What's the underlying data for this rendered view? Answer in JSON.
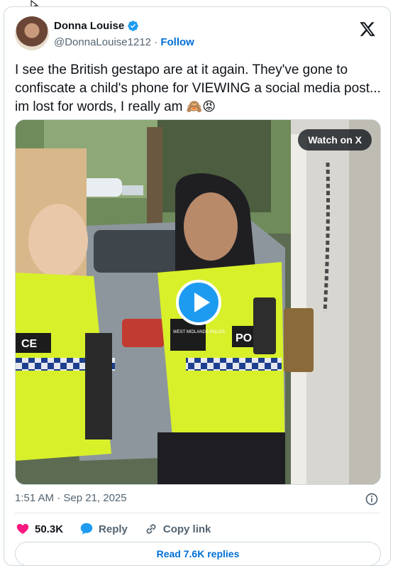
{
  "author": {
    "display_name": "Donna Louise",
    "handle": "@DonnaLouise1212",
    "separator": " · ",
    "follow_label": "Follow",
    "verified": true
  },
  "tweet": {
    "text": "I see the British gestapo are at it again. They've gone to confiscate a child's phone for VIEWING a social media post... im lost for words, I really am ",
    "emojis": "🙈😡"
  },
  "media": {
    "watch_label": "Watch on X",
    "vest_text_left": "CE",
    "vest_text_right": "PO",
    "badge_text": "WEST MIDLANDS POLICE"
  },
  "meta": {
    "timestamp": "1:51 AM · Sep 21, 2025"
  },
  "actions": {
    "likes": "50.3K",
    "reply_label": "Reply",
    "copy_label": "Copy link"
  },
  "replies": {
    "read_label": "Read 7.6K replies"
  },
  "colors": {
    "like": "#f91880",
    "reply": "#1d9bf0",
    "link": "#006fd6",
    "muted": "#536471",
    "hi_vis": "#d8f02a"
  },
  "icons": [
    "cursor-icon",
    "verified-badge-icon",
    "x-logo-icon",
    "play-icon",
    "info-icon",
    "heart-icon",
    "reply-bubble-icon",
    "link-icon"
  ]
}
